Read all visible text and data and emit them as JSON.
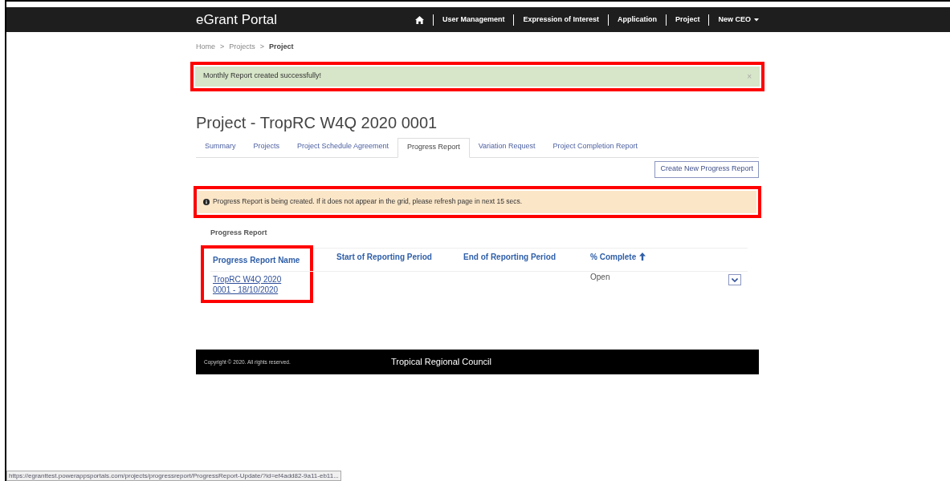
{
  "navbar": {
    "brand": "eGrant Portal",
    "links": [
      {
        "kind": "home"
      },
      {
        "kind": "text",
        "label": "User Management"
      },
      {
        "kind": "text",
        "label": "Expression of Interest"
      },
      {
        "kind": "text",
        "label": "Application"
      },
      {
        "kind": "text",
        "label": "Project"
      },
      {
        "kind": "dropdown",
        "label": "New CEO"
      }
    ]
  },
  "breadcrumb": [
    {
      "label": "Home",
      "current": false
    },
    {
      "label": "Projects",
      "current": false
    },
    {
      "label": "Project",
      "current": true
    }
  ],
  "breadcrumb_separator": ">",
  "success_alert": {
    "text": "Monthly Report created successfully!",
    "close": "×",
    "highlighted": true
  },
  "title": "Project - TropRC W4Q 2020 0001",
  "tabs": [
    {
      "label": "Summary",
      "selected": false
    },
    {
      "label": "Projects",
      "selected": false
    },
    {
      "label": "Project Schedule Agreement",
      "selected": false
    },
    {
      "label": "Progress Report",
      "selected": true
    },
    {
      "label": "Variation Request",
      "selected": false
    },
    {
      "label": "Project Completion Report",
      "selected": false
    }
  ],
  "create_button": "Create New Progress Report",
  "info_alert": {
    "text": "Progress Report is being created. If it does not appear in the grid, please refresh page in next 15 secs.",
    "highlighted": true
  },
  "table": {
    "title": "Progress Report",
    "columns": [
      {
        "label": "Progress Report Name",
        "sorted": false,
        "highlighted": true
      },
      {
        "label": "Start of Reporting Period",
        "sorted": false,
        "highlighted": false
      },
      {
        "label": "End of Reporting Period",
        "sorted": false,
        "highlighted": false
      },
      {
        "label": "% Complete",
        "sorted": true,
        "highlighted": false
      }
    ],
    "rows": [
      {
        "name": "TropRC W4Q 2020 0001 - 18/10/2020",
        "start": "",
        "end": "",
        "complete": "Open"
      }
    ]
  },
  "footer": {
    "copyright": "Copyright © 2020. All rights reserved.",
    "council": "Tropical Regional Council"
  },
  "status_bar": "https://egranttest.powerappsportals.com/projects/progressreport/ProgressReport-Update/?id=ef4add82-9a11-eb11..."
}
